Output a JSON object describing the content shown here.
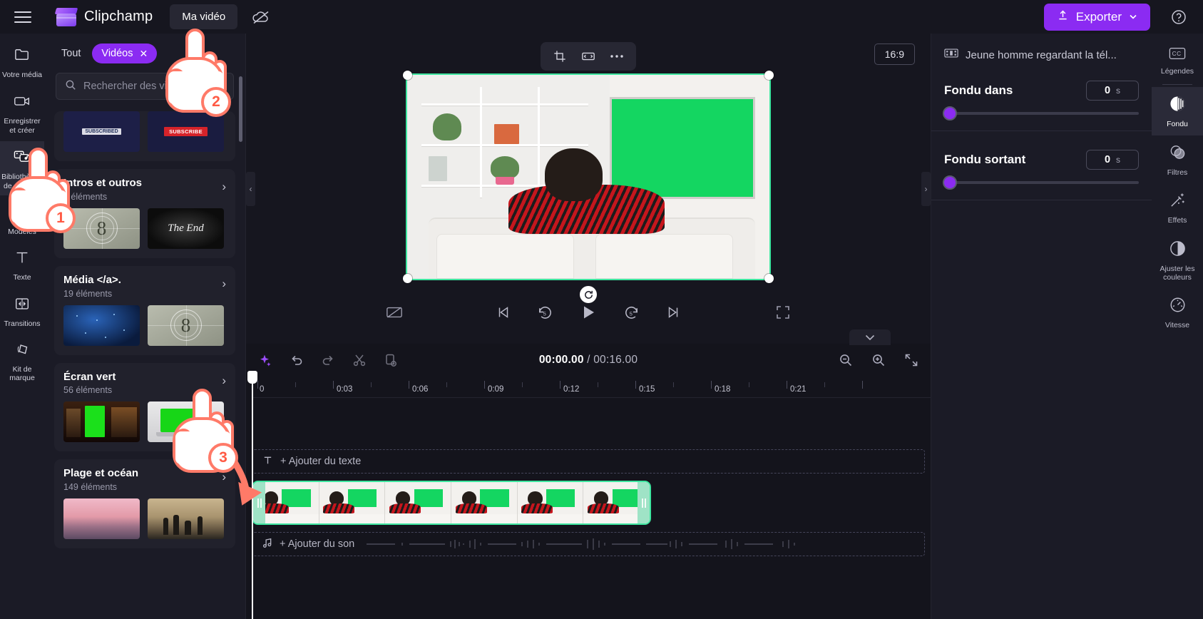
{
  "header": {
    "menu_icon": "hamburger-icon",
    "brand": "Clipchamp",
    "project_title": "Ma vidéo",
    "cloud_icon": "cloud-off-icon",
    "export_label": "Exporter",
    "export_icon": "upload-icon",
    "export_chevron": "chevron-down-icon",
    "help_icon": "help-circle-icon",
    "export_color": "#8b2bf2"
  },
  "rail": {
    "items": [
      {
        "label": "Votre média",
        "icon": "folder-icon",
        "active": false
      },
      {
        "label": "Enregistrer et créer",
        "icon": "record-camera-icon",
        "active": false
      },
      {
        "label": "Bibliothèque de contenu",
        "icon": "content-library-icon",
        "active": true
      },
      {
        "label": "Modèles",
        "icon": "templates-grid-icon",
        "active": false
      },
      {
        "label": "Texte",
        "icon": "text-t-icon",
        "active": false
      },
      {
        "label": "Transitions",
        "icon": "transitions-icon",
        "active": false
      },
      {
        "label": "Kit de marque",
        "icon": "brand-kit-icon",
        "active": false
      }
    ]
  },
  "library": {
    "filter_all": "Tout",
    "filter_selected": "Vidéos",
    "filter_close_icon": "close-x-icon",
    "search_placeholder": "Rechercher des vidéos",
    "search_value": "",
    "search_icon": "search-icon",
    "categories": [
      {
        "title": "",
        "count": "",
        "arrow_icon": "chevron-right-icon",
        "thumbs": [
          "subscribed-banner",
          "subscribe-button"
        ]
      },
      {
        "title": "Intros et outros",
        "count": "3 éléments",
        "arrow_icon": "chevron-right-icon",
        "thumbs": [
          "countdown-8",
          "the-end"
        ]
      },
      {
        "title": "Média </a>.",
        "count": "19 éléments",
        "arrow_icon": "chevron-right-icon",
        "thumbs": [
          "network-globe",
          "countdown-8"
        ]
      },
      {
        "title": "Écran vert",
        "count": "56 éléments",
        "arrow_icon": "chevron-right-icon",
        "thumbs": [
          "green-billboard-street",
          "green-laptop"
        ]
      },
      {
        "title": "Plage et océan",
        "count": "149 éléments",
        "arrow_icon": "chevron-right-icon",
        "thumbs": [
          "pink-sunset-sea",
          "beach-silhouettes"
        ]
      }
    ]
  },
  "stage": {
    "tools": [
      {
        "icon": "crop-icon"
      },
      {
        "icon": "flip-horizontal-icon"
      },
      {
        "icon": "more-horizontal-icon"
      }
    ],
    "aspect_ratio": "16:9",
    "rotate_icon": "rotate-icon",
    "controls": [
      {
        "icon": "captions-off-icon",
        "name": "captions-toggle"
      },
      {
        "icon": "skip-previous-icon",
        "name": "jump-to-start"
      },
      {
        "icon": "rewind-5-icon",
        "name": "rewind-5-seconds"
      },
      {
        "icon": "play-icon",
        "name": "play-button"
      },
      {
        "icon": "forward-5-icon",
        "name": "forward-5-seconds"
      },
      {
        "icon": "skip-next-icon",
        "name": "jump-to-end"
      },
      {
        "icon": "fullscreen-icon",
        "name": "fullscreen-button"
      }
    ],
    "collapse_left_icon": "chevron-left-icon",
    "collapse_right_icon": "chevron-right-icon",
    "selection_color": "#3ee6a0"
  },
  "timeline": {
    "collapse_icon": "chevron-down-icon",
    "tools": [
      {
        "icon": "magic-sparkle-icon",
        "name": "auto-compose-button"
      },
      {
        "icon": "undo-icon",
        "name": "undo-button"
      },
      {
        "icon": "redo-icon",
        "name": "redo-button"
      },
      {
        "icon": "scissors-icon",
        "name": "split-button"
      },
      {
        "icon": "duplicate-icon",
        "name": "duplicate-button"
      }
    ],
    "current_time": "00:00.00",
    "separator": "/",
    "total_time": "00:16.00",
    "right_tools": [
      {
        "icon": "zoom-out-icon",
        "name": "zoom-out-button"
      },
      {
        "icon": "zoom-in-icon",
        "name": "zoom-in-button"
      },
      {
        "icon": "fit-to-screen-icon",
        "name": "fit-timeline-button"
      }
    ],
    "ruler_labels": [
      "0",
      "0:03",
      "0:06",
      "0:09",
      "0:12",
      "0:15",
      "0:18",
      "0:21"
    ],
    "text_track_label": "+ Ajouter du texte",
    "text_track_icon": "text-t-icon",
    "audio_track_label": "+ Ajouter du son",
    "audio_track_icon": "music-note-icon",
    "clip_color": "#3ee6a0"
  },
  "rightpanel": {
    "clip_icon": "film-strip-icon",
    "clip_name": "Jeune homme regardant la tél...",
    "fade_in": {
      "label": "Fondu dans",
      "value": "0",
      "unit": "s"
    },
    "fade_out": {
      "label": "Fondu sortant",
      "value": "0",
      "unit": "s"
    },
    "accent_color": "#8b2bf2"
  },
  "tabstrip": {
    "tabs": [
      {
        "label": "Légendes",
        "icon": "closed-captions-icon",
        "active": false
      },
      {
        "label": "Fondu",
        "icon": "fade-icon",
        "active": true
      },
      {
        "label": "Filtres",
        "icon": "filters-icon",
        "active": false
      },
      {
        "label": "Effets",
        "icon": "effects-wand-icon",
        "active": false
      },
      {
        "label": "Ajuster les couleurs",
        "icon": "adjust-colors-icon",
        "active": false
      },
      {
        "label": "Vitesse",
        "icon": "speed-gauge-icon",
        "active": false
      }
    ]
  },
  "annotations": {
    "steps": [
      {
        "number": "1",
        "target": "sidebar-item-bibliotheque-de-contenu"
      },
      {
        "number": "2",
        "target": "filter-chip-videos"
      },
      {
        "number": "3",
        "target": "category-ecran-vert"
      }
    ],
    "accent": "#ff7a68"
  }
}
